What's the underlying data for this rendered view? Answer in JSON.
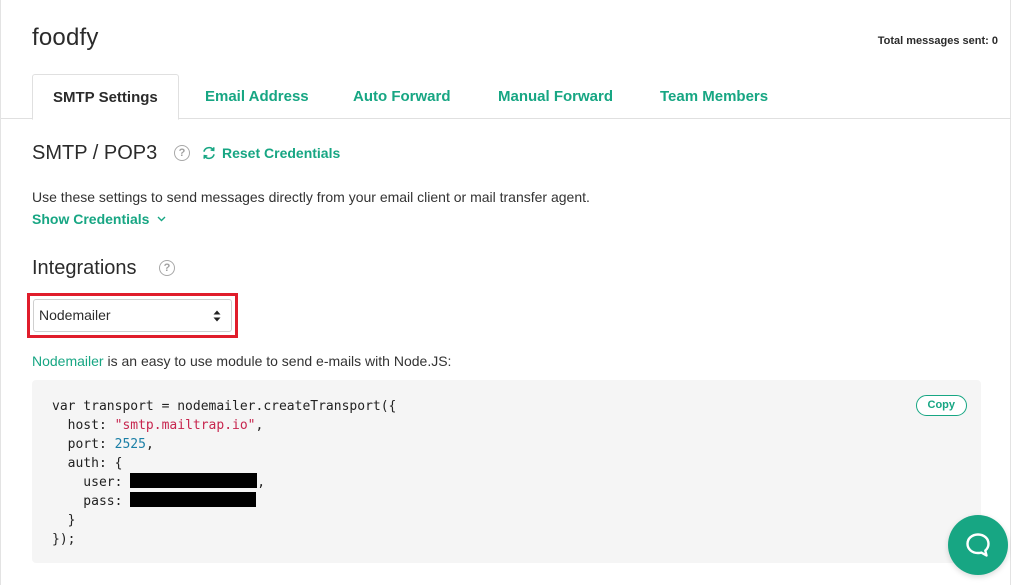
{
  "header": {
    "inbox_name": "foodfy",
    "total_messages": "Total messages sent: 0"
  },
  "tabs": [
    {
      "label": "SMTP Settings",
      "active": true
    },
    {
      "label": "Email Address",
      "active": false
    },
    {
      "label": "Auto Forward",
      "active": false
    },
    {
      "label": "Manual Forward",
      "active": false
    },
    {
      "label": "Team Members",
      "active": false
    }
  ],
  "smtp": {
    "title": "SMTP / POP3",
    "help_icon": "?",
    "reset_label": "Reset Credentials",
    "description": "Use these settings to send messages directly from your email client or mail transfer agent.",
    "show_credentials": "Show Credentials"
  },
  "integrations": {
    "title": "Integrations",
    "help_icon": "?",
    "selected": "Nodemailer",
    "intro_link": "Nodemailer",
    "intro_text": " is an easy to use module to send e-mails with Node.JS:",
    "copy_label": "Copy",
    "code": {
      "line1": "var transport = nodemailer.createTransport({",
      "host_key": "  host: ",
      "host_val": "\"smtp.mailtrap.io\"",
      "port_key": "  port: ",
      "port_val": "2525",
      "auth_line": "  auth: {",
      "user_key": "    user: ",
      "pass_key": "    pass: ",
      "close_auth": "  }",
      "close_all": "});"
    }
  },
  "colors": {
    "accent": "#17a683",
    "highlight_outline": "#e01d2b",
    "code_background": "#f5f5f5"
  },
  "icons": {
    "reset": "refresh-icon",
    "show_credentials": "chevron-down-icon",
    "select": "sort-arrows-icon",
    "chat": "chat-bubble-icon"
  }
}
